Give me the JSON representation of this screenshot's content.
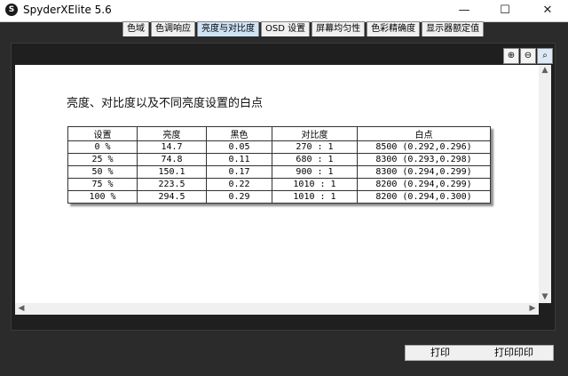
{
  "window": {
    "title": "SpyderXElite 5.6",
    "icon": "S",
    "minimize": "—",
    "maximize": "☐",
    "close": "✕"
  },
  "tabs": [
    {
      "label": "色域",
      "active": false
    },
    {
      "label": "色调响应",
      "active": false
    },
    {
      "label": "亮度与对比度",
      "active": true
    },
    {
      "label": "OSD 设置",
      "active": false
    },
    {
      "label": "屏幕均匀性",
      "active": false
    },
    {
      "label": "色彩精确度",
      "active": false
    },
    {
      "label": "显示器额定值",
      "active": false
    }
  ],
  "zoom": {
    "in": "⊕",
    "out": "⊖",
    "fit": "⌕"
  },
  "report": {
    "title": "亮度、对比度以及不同亮度设置的白点",
    "columns": [
      "设置",
      "亮度",
      "黑色",
      "对比度",
      "白点"
    ],
    "rows": [
      [
        "0 %",
        "14.7",
        "0.05",
        "270 : 1",
        "8500 (0.292,0.296)"
      ],
      [
        "25 %",
        "74.8",
        "0.11",
        "680 : 1",
        "8300 (0.293,0.298)"
      ],
      [
        "50 %",
        "150.1",
        "0.17",
        "900 : 1",
        "8300 (0.294,0.299)"
      ],
      [
        "75 %",
        "223.5",
        "0.22",
        "1010 : 1",
        "8200 (0.294,0.299)"
      ],
      [
        "100 %",
        "294.5",
        "0.29",
        "1010 : 1",
        "8200 (0.294,0.300)"
      ]
    ]
  },
  "buttons": {
    "print": "打印",
    "print_all": "打印印印"
  }
}
